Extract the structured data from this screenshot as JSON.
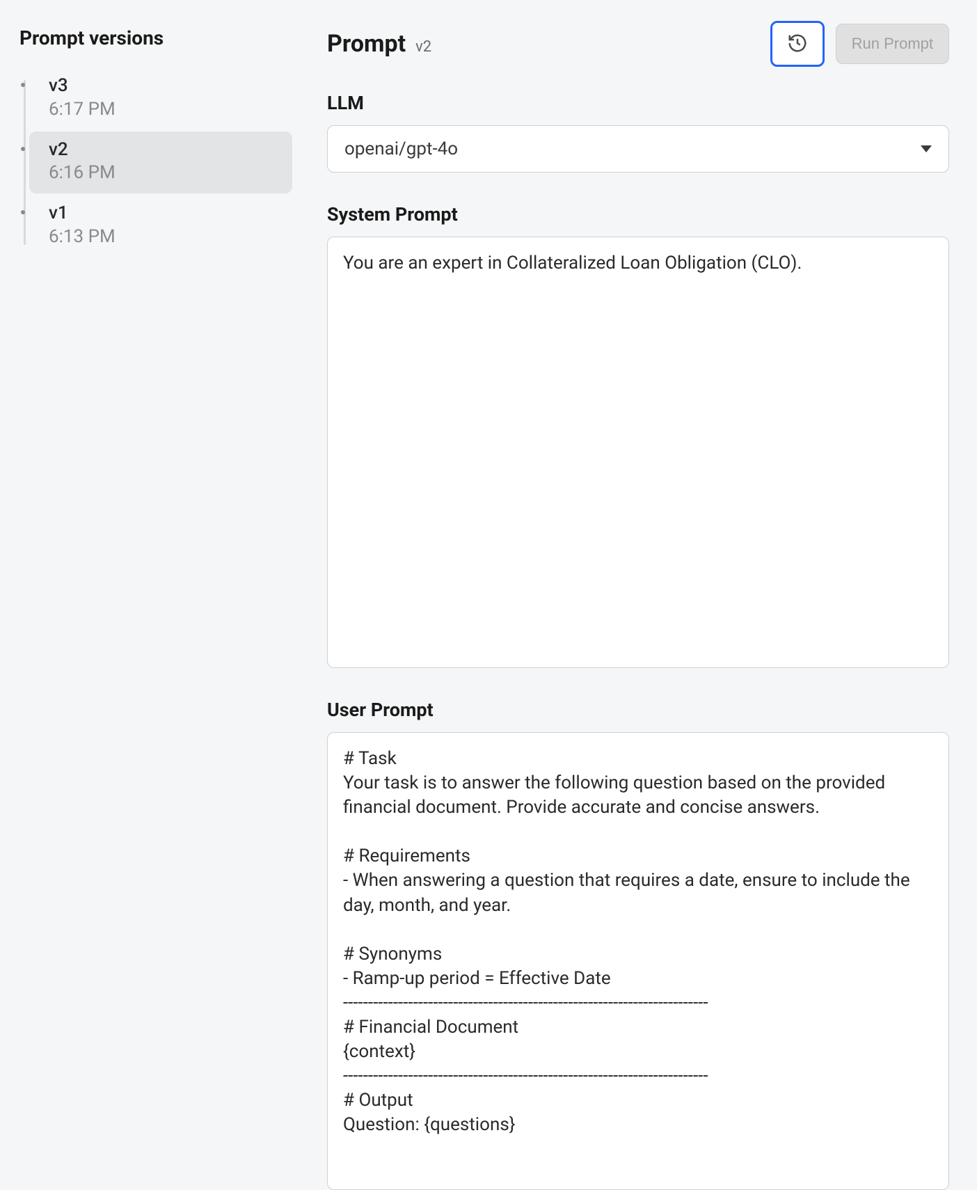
{
  "sidebar": {
    "title": "Prompt versions",
    "versions": [
      {
        "name": "v3",
        "time": "6:17 PM",
        "active": false
      },
      {
        "name": "v2",
        "time": "6:16 PM",
        "active": true
      },
      {
        "name": "v1",
        "time": "6:13 PM",
        "active": false
      }
    ]
  },
  "header": {
    "title": "Prompt",
    "version_tag": "v2",
    "run_button": "Run Prompt"
  },
  "llm": {
    "label": "LLM",
    "value": "openai/gpt-4o"
  },
  "system_prompt": {
    "label": "System Prompt",
    "value": "You are an expert in Collateralized Loan Obligation (CLO)."
  },
  "user_prompt": {
    "label": "User Prompt",
    "value": "# Task\nYour task is to answer the following question based on the provided financial document. Provide accurate and concise answers.\n\n# Requirements\n- When answering a question that requires a date, ensure to include the day, month, and year.\n\n# Synonyms\n- Ramp-up period = Effective Date\n-------------------------------------------------------------------------\n# Financial Document\n{context}\n-------------------------------------------------------------------------\n# Output\nQuestion: {questions}"
  }
}
